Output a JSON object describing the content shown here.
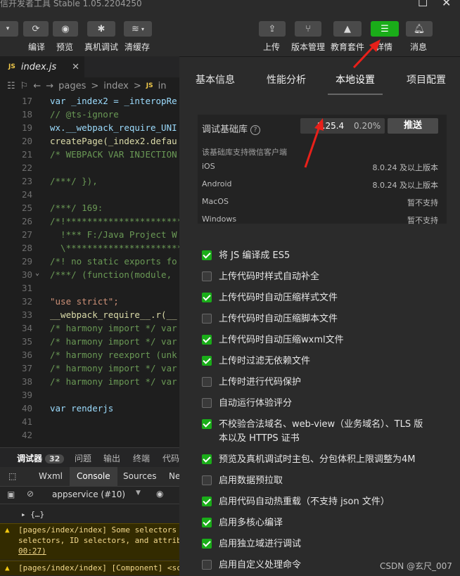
{
  "window": {
    "title": "信开发者工具 Stable 1.05.2204250"
  },
  "toolbar": {
    "left_buttons": [
      {
        "label": "编译"
      },
      {
        "label": "预览"
      },
      {
        "label": "真机调试"
      },
      {
        "label": "清缓存"
      }
    ],
    "right_buttons": [
      {
        "label": "上传"
      },
      {
        "label": "版本管理"
      },
      {
        "label": "教育套件"
      },
      {
        "label": "详情"
      },
      {
        "label": "消息"
      }
    ]
  },
  "editor": {
    "tab": {
      "badge": "JS",
      "name": "index.js"
    },
    "breadcrumb": [
      "pages",
      ">",
      "index",
      ">",
      "JS",
      "in"
    ],
    "lines": [
      {
        "n": "17",
        "text": "var _index2 = _interopRe"
      },
      {
        "n": "18",
        "text": "// @ts-ignore"
      },
      {
        "n": "19",
        "text": "wx.__webpack_require_UNI"
      },
      {
        "n": "20",
        "text": "createPage(_index2.defau"
      },
      {
        "n": "21",
        "text": "/* WEBPACK VAR INJECTION"
      },
      {
        "n": "22",
        "text": ""
      },
      {
        "n": "23",
        "text": "/***/ }),"
      },
      {
        "n": "24",
        "text": ""
      },
      {
        "n": "25",
        "text": "/***/ 169:"
      },
      {
        "n": "26",
        "text": "/*!**********************"
      },
      {
        "n": "27",
        "text": "  !*** F:/Java Project W"
      },
      {
        "n": "28",
        "text": "  \\**********************"
      },
      {
        "n": "29",
        "text": "/*! no static exports fo"
      },
      {
        "n": "30",
        "text": "/***/ (function(module, "
      },
      {
        "n": "31",
        "text": ""
      },
      {
        "n": "32",
        "text": "\"use strict\";"
      },
      {
        "n": "33",
        "text": "__webpack_require__.r(__"
      },
      {
        "n": "34",
        "text": "/* harmony import */ var"
      },
      {
        "n": "35",
        "text": "/* harmony import */ var"
      },
      {
        "n": "36",
        "text": "/* harmony reexport (unk"
      },
      {
        "n": "37",
        "text": "/* harmony import */ var"
      },
      {
        "n": "38",
        "text": "/* harmony import */ var"
      },
      {
        "n": "39",
        "text": ""
      },
      {
        "n": "40",
        "text": "var renderjs"
      },
      {
        "n": "41",
        "text": ""
      },
      {
        "n": "42",
        "text": ""
      }
    ]
  },
  "debugger": {
    "tabs": [
      {
        "label": "调试器",
        "count": "32"
      },
      {
        "label": "问题"
      },
      {
        "label": "输出"
      },
      {
        "label": "终端"
      },
      {
        "label": "代码"
      }
    ],
    "devtools_tabs": [
      "Wxml",
      "Console",
      "Sources",
      "Ne"
    ],
    "context": "appservice (#10)",
    "console": {
      "collapsed": "{…}",
      "warn1_l1": "[pages/index/index] Some selectors",
      "warn1_l2": "selectors, ID selectors, and attrib",
      "warn1_l3": "00:27)",
      "warn2": "[pages/index/index] [Component] <sc"
    }
  },
  "details": {
    "tabs": [
      "基本信息",
      "性能分析",
      "本地设置",
      "项目配置"
    ],
    "lib": {
      "label": "调试基础库",
      "version": "2.25.4",
      "percent": "0.20%",
      "push_label": "推送",
      "note": "该基础库支持微信客户端"
    },
    "platforms": [
      {
        "name": "iOS",
        "req": "8.0.24 及以上版本"
      },
      {
        "name": "Android",
        "req": "8.0.24 及以上版本"
      },
      {
        "name": "MacOS",
        "req": "暂不支持"
      },
      {
        "name": "Windows",
        "req": "暂不支持"
      }
    ],
    "options": [
      {
        "label": "将 JS 编译成 ES5",
        "checked": true
      },
      {
        "label": "上传代码时样式自动补全",
        "checked": false
      },
      {
        "label": "上传代码时自动压缩样式文件",
        "checked": true
      },
      {
        "label": "上传代码时自动压缩脚本文件",
        "checked": false
      },
      {
        "label": "上传代码时自动压缩wxml文件",
        "checked": true
      },
      {
        "label": "上传时过滤无依赖文件",
        "checked": true
      },
      {
        "label": "上传时进行代码保护",
        "checked": false
      },
      {
        "label": "自动运行体验评分",
        "checked": false
      },
      {
        "label": "不校验合法域名、web-view（业务域名）、TLS 版本以及 HTTPS 证书",
        "checked": true
      },
      {
        "label": "预览及真机调试时主包、分包体积上限调整为4M",
        "checked": true
      },
      {
        "label": "启用数据预拉取",
        "checked": false
      },
      {
        "label": "启用代码自动热重载（不支持 json 文件）",
        "checked": true
      },
      {
        "label": "启用多核心编译",
        "checked": true
      },
      {
        "label": "启用独立域进行调试",
        "checked": true
      },
      {
        "label": "启用自定义处理命令",
        "checked": false
      }
    ]
  },
  "watermark": "CSDN @玄尺_007",
  "colors": {
    "accent_green": "#1aad19",
    "annotation_red": "#e8201a"
  }
}
